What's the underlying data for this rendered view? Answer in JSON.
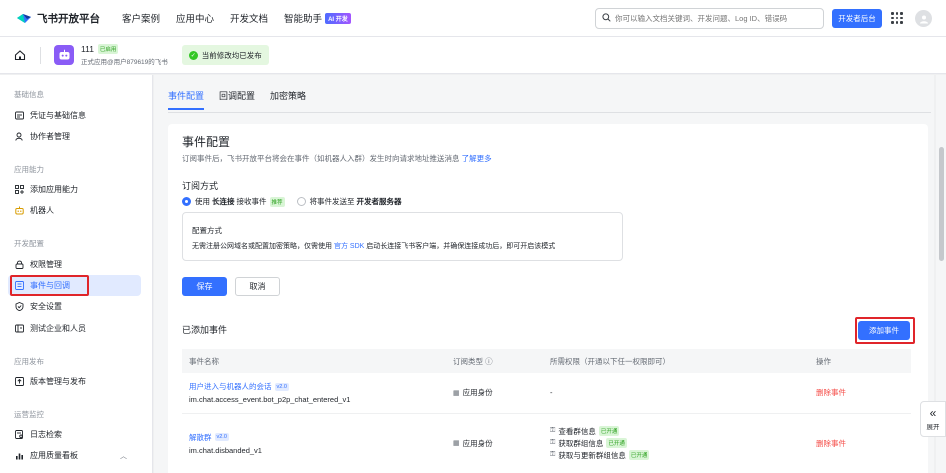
{
  "topnav": {
    "logo_text": "飞书开放平台",
    "links": [
      "客户案例",
      "应用中心",
      "开发文档",
      "智能助手"
    ],
    "ai_badge": "AI 开发",
    "search_placeholder": "你可以输入文档关键词、开发问题、Log ID、错误码",
    "dev_console": "开发者后台"
  },
  "appbar": {
    "app_name": "111",
    "status_tag": "已启用",
    "app_sub": "正式应用@用户879619的飞书",
    "publish_status": "当前修改均已发布"
  },
  "sidebar": {
    "groups": [
      "基础信息",
      "应用能力",
      "开发配置",
      "应用发布",
      "运营监控"
    ],
    "items": [
      {
        "label": "凭证与基础信息",
        "icon": "credential-icon"
      },
      {
        "label": "协作者管理",
        "icon": "person-icon"
      },
      {
        "label": "添加应用能力",
        "icon": "apps-icon"
      },
      {
        "label": "机器人",
        "icon": "robot-icon"
      },
      {
        "label": "权限管理",
        "icon": "lock-icon"
      },
      {
        "label": "事件与回调",
        "icon": "event-icon"
      },
      {
        "label": "安全设置",
        "icon": "shield-icon"
      },
      {
        "label": "测试企业和人员",
        "icon": "test-icon"
      },
      {
        "label": "版本管理与发布",
        "icon": "version-icon"
      },
      {
        "label": "日志检索",
        "icon": "log-icon"
      },
      {
        "label": "应用质量看板",
        "icon": "chart-icon"
      }
    ]
  },
  "tabs": [
    "事件配置",
    "回调配置",
    "加密策略"
  ],
  "event_config": {
    "title": "事件配置",
    "desc": "订阅事件后，飞书开放平台将会在事件（如机器人入群）发生时向请求地址推送消息",
    "learn_more": "了解更多",
    "subscribe_title": "订阅方式",
    "option1_pre": "使用",
    "option1_bold": "长连接",
    "option1_post": "接收事件",
    "option1_tag": "推荐",
    "option2_pre": "将事件发送至",
    "option2_bold": "开发者服务器",
    "cfg_title": "配置方式",
    "cfg_text_pre": "无需注册公网域名或配置加密策略，仅需使用",
    "cfg_link": "官方 SDK",
    "cfg_text_post": "启动长连接飞书客户端，并确保连接成功后，即可开启该模式",
    "save": "保存",
    "cancel": "取消",
    "added_title": "已添加事件",
    "add_button": "添加事件"
  },
  "table": {
    "headers": [
      "事件名称",
      "订阅类型",
      "所需权限（开通以下任一权限即可）",
      "操作"
    ],
    "rows": [
      {
        "name": "用户进入与机器人的会话",
        "version": "v2.0",
        "key": "im.chat.access_event.bot_p2p_chat_entered_v1",
        "type": "应用身份",
        "perms": [
          {
            "label": "-",
            "tag": ""
          }
        ],
        "action": "删除事件"
      },
      {
        "name": "解散群",
        "version": "v2.0",
        "key": "im.chat.disbanded_v1",
        "type": "应用身份",
        "perms": [
          {
            "label": "查看群信息",
            "tag": "已开通"
          },
          {
            "label": "获取群组信息",
            "tag": "已开通"
          },
          {
            "label": "获取与更新群组信息",
            "tag": "已开通"
          }
        ],
        "action": "删除事件"
      }
    ]
  },
  "expand_label": "展开",
  "colors": {
    "accent": "#3370ff",
    "danger": "#f54a45",
    "success": "#2ea121",
    "highlight": "#e0252a"
  }
}
